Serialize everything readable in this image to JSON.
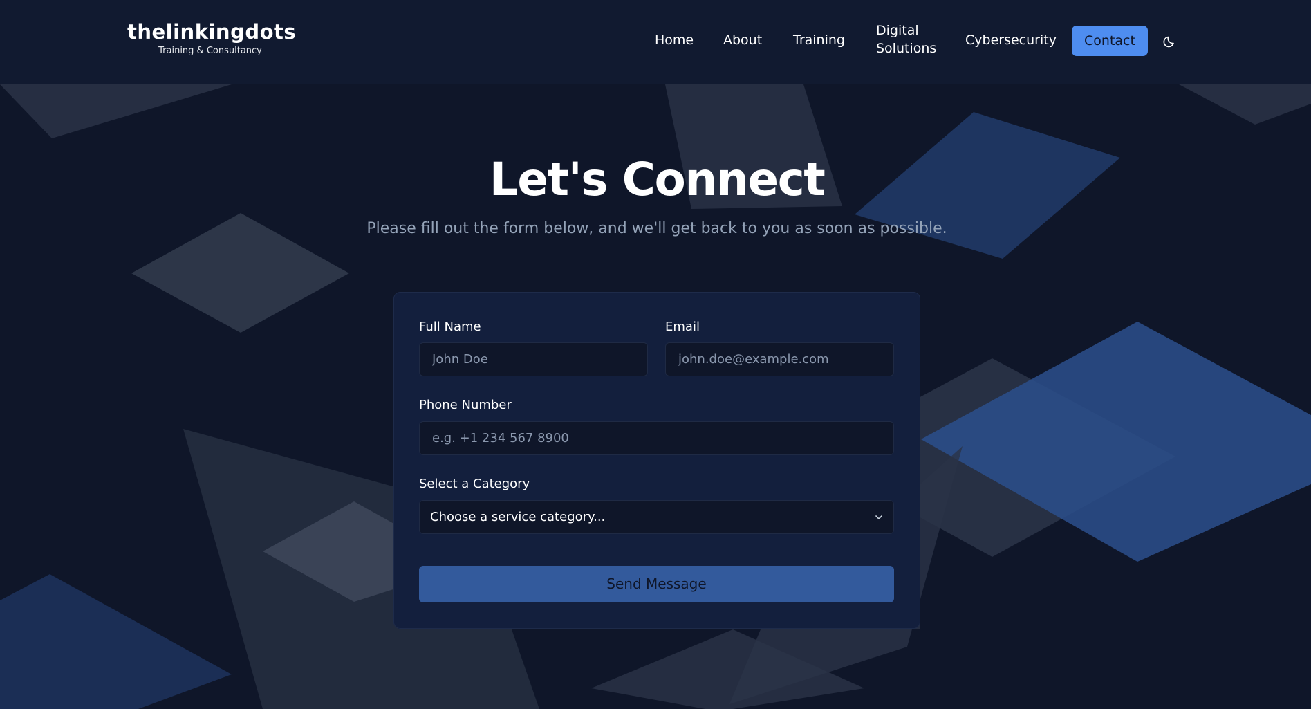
{
  "brand": {
    "name": "thelinkingdots",
    "tagline": "Training & Consultancy"
  },
  "nav": {
    "items": [
      {
        "label": "Home"
      },
      {
        "label": "About"
      },
      {
        "label": "Training"
      },
      {
        "label": "Digital Solutions"
      },
      {
        "label": "Cybersecurity"
      }
    ],
    "cta_label": "Contact",
    "theme_toggle_icon": "moon-icon"
  },
  "hero": {
    "title": "Let's Connect",
    "subtitle": "Please fill out the form below, and we'll get back to you as soon as possible."
  },
  "form": {
    "full_name": {
      "label": "Full Name",
      "placeholder": "John Doe",
      "value": ""
    },
    "email": {
      "label": "Email",
      "placeholder": "john.doe@example.com",
      "value": ""
    },
    "phone": {
      "label": "Phone Number",
      "placeholder": "e.g. +1 234 567 8900",
      "value": ""
    },
    "category": {
      "label": "Select a Category",
      "selected": "Choose a service category...",
      "icon": "chevron-down-icon"
    },
    "submit_label": "Send Message"
  },
  "colors": {
    "background": "#0f1629",
    "nav_background": "#111a30",
    "card_background": "#131f3d",
    "accent": "#4e8df0",
    "submit_button": "#335a9c",
    "subtitle_text": "#94a3b8"
  }
}
